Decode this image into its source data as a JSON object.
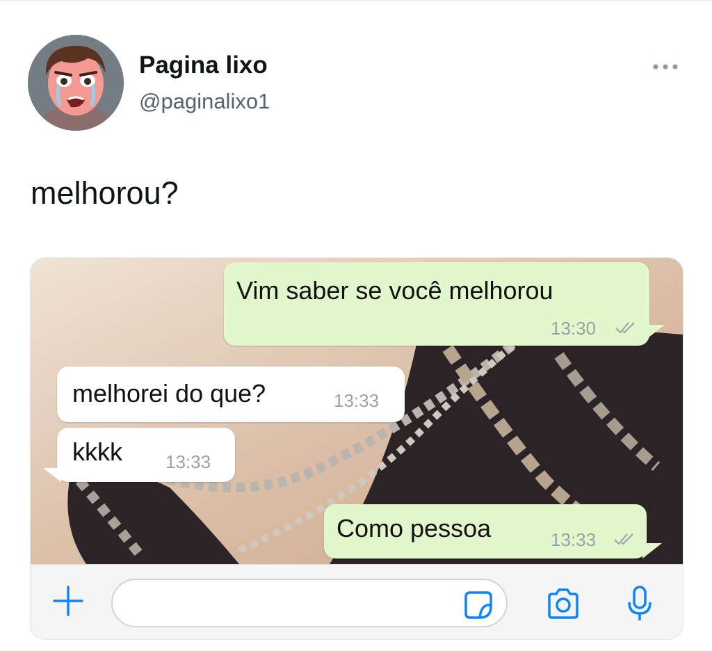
{
  "tweet": {
    "display_name": "Pagina lixo",
    "handle": "@paginalixo1",
    "text": "melhorou?",
    "more_icon": "more-horizontal-icon"
  },
  "chat": {
    "messages": [
      {
        "direction": "outgoing",
        "text": "Vim saber se você melhorou",
        "time": "13:30",
        "status": "read"
      },
      {
        "direction": "incoming",
        "text": "melhorei do que?",
        "time": "13:33"
      },
      {
        "direction": "incoming",
        "text": "kkkk",
        "time": "13:33"
      },
      {
        "direction": "outgoing",
        "text": "Como pessoa",
        "time": "13:33",
        "status": "read"
      }
    ],
    "composer": {
      "input_value": "",
      "icons": [
        "plus-icon",
        "sticker-icon",
        "camera-icon",
        "microphone-icon"
      ]
    }
  },
  "colors": {
    "accent_blue": "#0a84ff",
    "outgoing_bubble": "#e2f7cb",
    "incoming_bubble": "#ffffff"
  }
}
